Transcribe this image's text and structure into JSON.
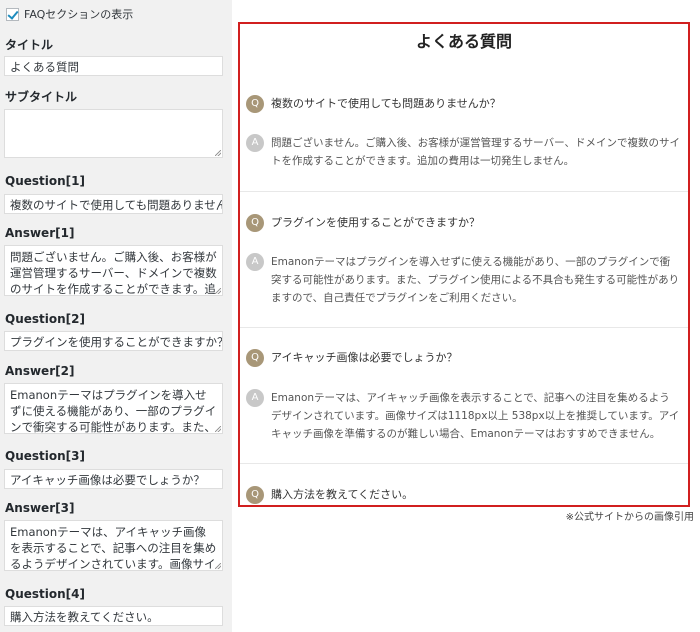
{
  "panel": {
    "show_faq_label": "FAQセクションの表示",
    "title_label": "タイトル",
    "title_value": "よくある質問",
    "subtitle_label": "サブタイトル",
    "subtitle_value": "",
    "questions": [
      {
        "q_label": "Question[1]",
        "q_value": "複数のサイトで使用しても問題ありませんか？",
        "a_label": "Answer[1]",
        "a_value": "問題ございません。ご購入後、お客様が運営管理するサーバー、ドメインで複数のサイトを作成することができます。追加の費用は一切発生しません。"
      },
      {
        "q_label": "Question[2]",
        "q_value": "プラグインを使用することができますか？",
        "a_label": "Answer[2]",
        "a_value": "Emanonテーマはプラグインを導入せずに使える機能があり、一部のプラグインで衝突する可能性があります。また、プラグイン使用による不具合も発生する可能性がありますので、自己責任でプラグインをご利用ください。"
      },
      {
        "q_label": "Question[3]",
        "q_value": "アイキャッチ画像は必要でしょうか？",
        "a_label": "Answer[3]",
        "a_value": "Emanonテーマは、アイキャッチ画像を表示することで、記事への注目を集めるようデザインされています。画像サイズは1118px以上 538px以上を推奨しています。アイキャッチ画像を準備するのが難しい場合、Emanonテーマはおすすめできません。"
      },
      {
        "q_label": "Question[4]",
        "q_value": "購入方法を教えてください。"
      }
    ]
  },
  "preview": {
    "title": "よくある質問",
    "q_badge": "Q",
    "a_badge": "A",
    "items": [
      {
        "q": "複数のサイトで使用しても問題ありませんか？",
        "a": "問題ございません。ご購入後、お客様が運営管理するサーバー、ドメインで複数のサイトを作成することができます。追加の費用は一切発生しません。"
      },
      {
        "q": "プラグインを使用することができますか？",
        "a": "Emanonテーマはプラグインを導入せずに使える機能があり、一部のプラグインで衝突する可能性があります。また、プラグイン使用による不具合も発生する可能性がありますので、自己責任でプラグインをご利用ください。"
      },
      {
        "q": "アイキャッチ画像は必要でしょうか？",
        "a": "Emanonテーマは、アイキャッチ画像を表示することで、記事への注目を集めるようデザインされています。画像サイズは1118px以上 538px以上を推奨しています。アイキャッチ画像を準備するのが難しい場合、Emanonテーマはおすすめできません。"
      },
      {
        "q": "購入方法を教えてください。"
      }
    ]
  },
  "note": "※公式サイトからの画像引用",
  "colors": {
    "frame": "#d11f1f",
    "q_badge": "#a89778",
    "a_badge": "#c8c8c8"
  }
}
